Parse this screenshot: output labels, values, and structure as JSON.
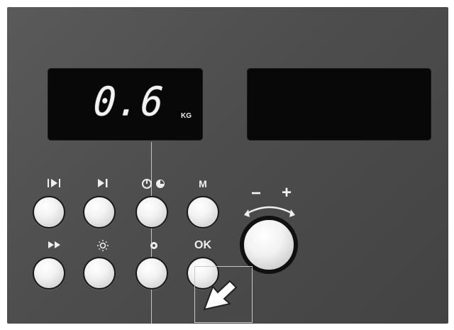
{
  "display": {
    "value": "0.6",
    "unit": "KG"
  },
  "top_buttons": [
    {
      "icon": "skip-program-icon",
      "label": ""
    },
    {
      "icon": "start-pause-icon",
      "label": ""
    },
    {
      "icon": "timer-icon",
      "label": ""
    },
    {
      "icon": "memory-label",
      "label": "M"
    }
  ],
  "bottom_buttons": [
    {
      "icon": "fast-forward-icon",
      "label": ""
    },
    {
      "icon": "light-icon",
      "label": ""
    },
    {
      "icon": "setting-icon",
      "label": ""
    },
    {
      "icon": "ok-label",
      "label": "OK"
    }
  ],
  "knob": {
    "minus_label": "−",
    "plus_label": "+"
  },
  "colors": {
    "panel": "#4f4f4f",
    "display_background": "#080808",
    "display_text": "#f2f2f2",
    "button_face": "#f2f2f2",
    "button_border": "#1a1a1a"
  }
}
